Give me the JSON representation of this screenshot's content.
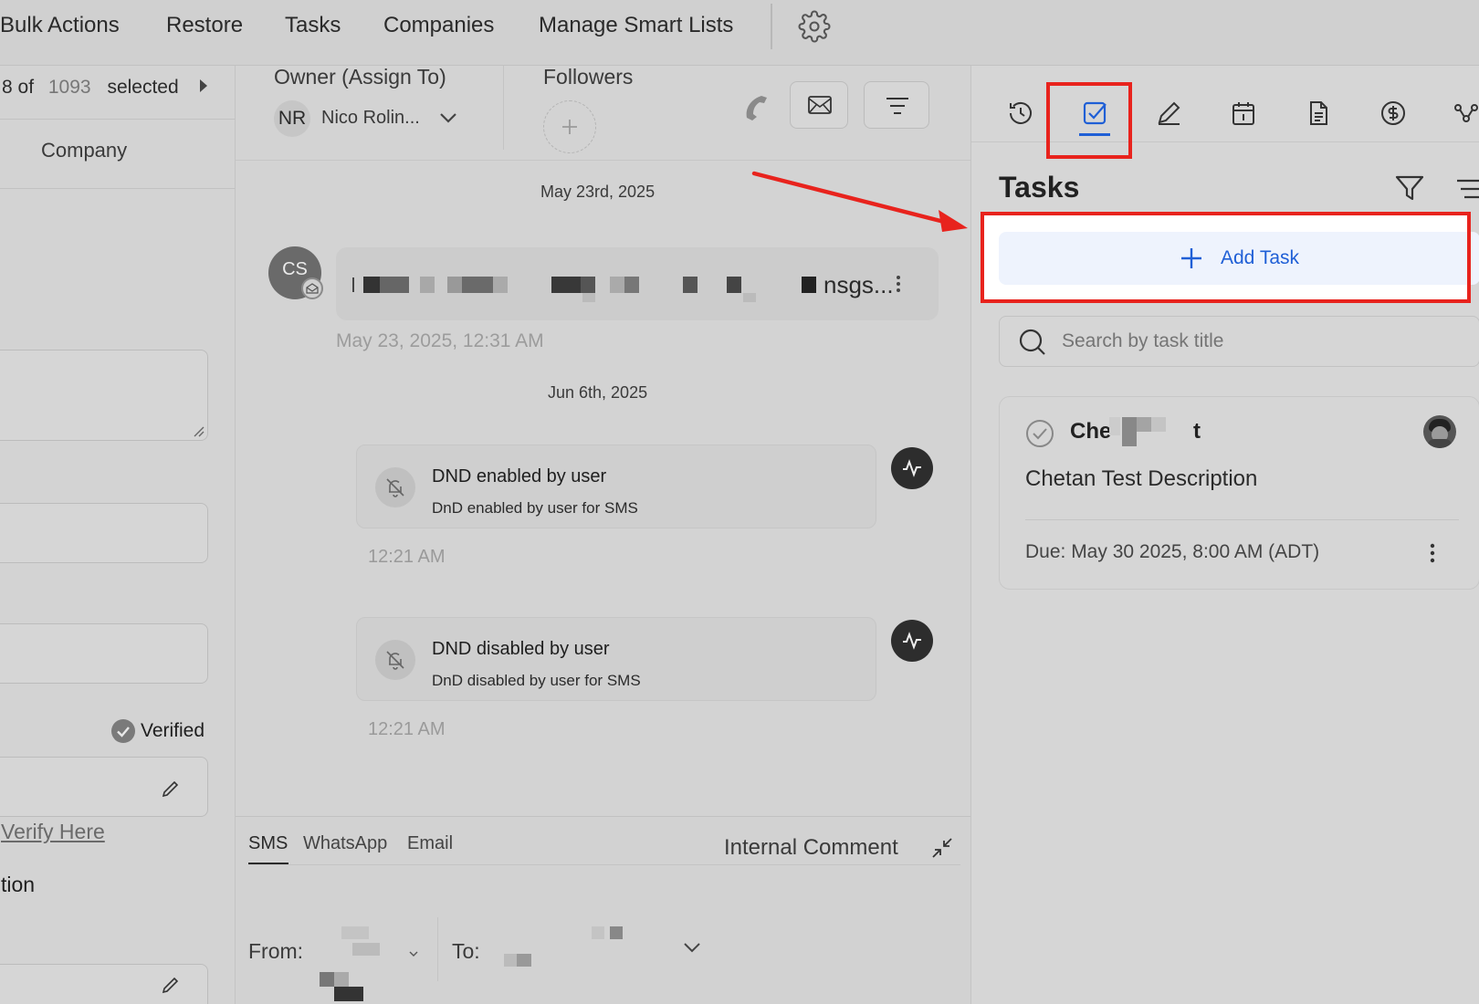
{
  "topnav": {
    "items": [
      "Bulk Actions",
      "Restore",
      "Tasks",
      "Companies",
      "Manage Smart Lists"
    ],
    "settings_icon": "gear-icon"
  },
  "left": {
    "selection": {
      "prefix": "8 of",
      "total": "1093",
      "suffix": "selected"
    },
    "column_header": "Company",
    "verified_label": "Verified",
    "verify_link": "Verify Here",
    "truncated_label": "tion"
  },
  "conversation": {
    "owner_label": "Owner (Assign To)",
    "owner_initials": "NR",
    "owner_name": "Nico Rolin...",
    "followers_label": "Followers",
    "dates": [
      "May 23rd, 2025",
      "Jun 6th, 2025"
    ],
    "message": {
      "avatar_initials": "CS",
      "preview_tail": "nsgs...",
      "timestamp": "May 23, 2025, 12:31 AM"
    },
    "activities": [
      {
        "title": "DND enabled by user",
        "subtitle": "DnD enabled by user for SMS",
        "time": "12:21 AM"
      },
      {
        "title": "DND disabled by user",
        "subtitle": "DnD disabled by user for SMS",
        "time": "12:21 AM"
      }
    ],
    "composer": {
      "tabs": [
        "SMS",
        "WhatsApp",
        "Email"
      ],
      "active_tab": "SMS",
      "internal_comment": "Internal Comment",
      "from_label": "From:",
      "to_label": "To:"
    }
  },
  "tasks_panel": {
    "title": "Tasks",
    "tab_icons": [
      "history-icon",
      "task-check-icon",
      "pencil-icon",
      "calendar-icon",
      "document-icon",
      "dollar-icon",
      "workflow-icon"
    ],
    "active_tab": "task-check-icon",
    "add_task_label": "Add Task",
    "search_placeholder": "Search by task title",
    "task": {
      "title_start": "Che",
      "title_end": "t",
      "description": "Chetan Test Description",
      "due": "Due: May 30 2025, 8:00 AM (ADT)"
    }
  },
  "colors": {
    "accent": "#1f5fd6",
    "annotation_red": "#e8231d",
    "add_task_bg": "#eef3fd"
  }
}
